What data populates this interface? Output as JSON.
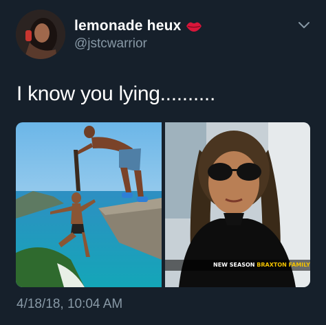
{
  "user": {
    "display_name": "lemonade heux",
    "handle": "@jstcwarrior",
    "badge_icon": "lips-icon",
    "badge_color": "#d8163a"
  },
  "tweet": {
    "text": "I know you lying..........",
    "timestamp": "4/18/18, 10:04 AM"
  },
  "media": {
    "right_caption_white": "NEW SEASON",
    "right_caption_yellow": "BRAXTON FAMILY VALUES TI"
  },
  "colors": {
    "background": "#16202b",
    "secondary_text": "#8899a6",
    "primary_text": "#ffffff"
  }
}
